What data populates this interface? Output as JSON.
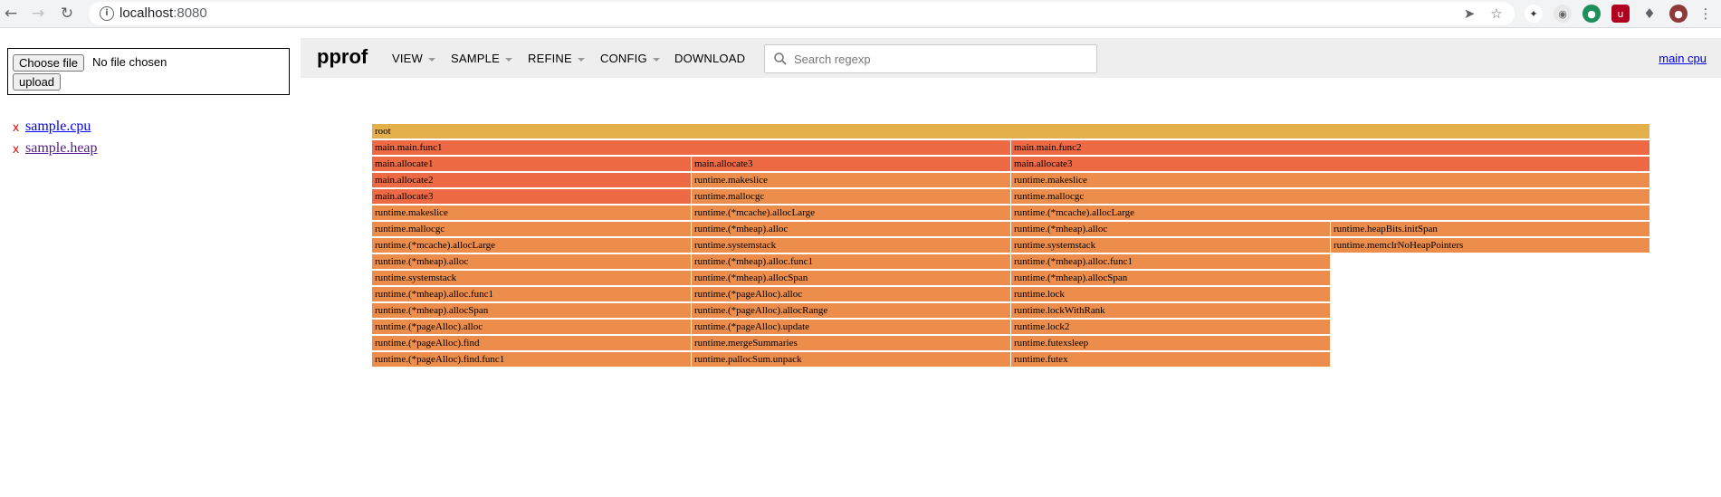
{
  "browser": {
    "url_host": "localhost",
    "url_port": ":8080",
    "icons": [
      "back-icon",
      "forward-icon",
      "reload-icon",
      "info-icon",
      "send-icon",
      "star-icon",
      "extension-icons",
      "puzzle-icon",
      "profile-avatar",
      "kebab-menu-icon"
    ]
  },
  "upload": {
    "choose_label": "Choose file",
    "no_file_text": "No file chosen",
    "upload_label": "upload"
  },
  "files": [
    {
      "x": "x",
      "name": "sample.cpu",
      "visited": false
    },
    {
      "x": "x",
      "name": "sample.heap",
      "visited": true
    }
  ],
  "header": {
    "title": "pprof",
    "menu": [
      "VIEW",
      "SAMPLE",
      "REFINE",
      "CONFIG",
      "DOWNLOAD"
    ],
    "search_placeholder": "Search regexp",
    "profile_link": "main cpu"
  },
  "colors": {
    "root": "#e3b04b",
    "hot": "#ee6a45",
    "warm": "#ec8d4b",
    "header_bg": "#eeeeee",
    "link": "#0000ee"
  },
  "flame": {
    "rows": [
      [
        {
          "name": "root",
          "w": 4,
          "c": "root"
        }
      ],
      [
        {
          "name": "main.main.func1",
          "w": 2,
          "c": "hot"
        },
        {
          "name": "main.main.func2",
          "w": 2,
          "c": "hot"
        }
      ],
      [
        {
          "name": "main.allocate1",
          "w": 1,
          "c": "hot"
        },
        {
          "name": "main.allocate3",
          "w": 1,
          "c": "hot"
        },
        {
          "name": "main.allocate3",
          "w": 2,
          "c": "hot"
        }
      ],
      [
        {
          "name": "main.allocate2",
          "w": 1,
          "c": "hot"
        },
        {
          "name": "runtime.makeslice",
          "w": 1,
          "c": "warm"
        },
        {
          "name": "runtime.makeslice",
          "w": 2,
          "c": "warm"
        }
      ],
      [
        {
          "name": "main.allocate3",
          "w": 1,
          "c": "hot"
        },
        {
          "name": "runtime.mallocgc",
          "w": 1,
          "c": "warm"
        },
        {
          "name": "runtime.mallocgc",
          "w": 2,
          "c": "warm"
        }
      ],
      [
        {
          "name": "runtime.makeslice",
          "w": 1,
          "c": "warm"
        },
        {
          "name": "runtime.(*mcache).allocLarge",
          "w": 1,
          "c": "warm"
        },
        {
          "name": "runtime.(*mcache).allocLarge",
          "w": 2,
          "c": "warm"
        }
      ],
      [
        {
          "name": "runtime.mallocgc",
          "w": 1,
          "c": "warm"
        },
        {
          "name": "runtime.(*mheap).alloc",
          "w": 1,
          "c": "warm"
        },
        {
          "name": "runtime.(*mheap).alloc",
          "w": 1,
          "c": "warm"
        },
        {
          "name": "runtime.heapBits.initSpan",
          "w": 1,
          "c": "warm"
        }
      ],
      [
        {
          "name": "runtime.(*mcache).allocLarge",
          "w": 1,
          "c": "warm"
        },
        {
          "name": "runtime.systemstack",
          "w": 1,
          "c": "warm"
        },
        {
          "name": "runtime.systemstack",
          "w": 1,
          "c": "warm"
        },
        {
          "name": "runtime.memclrNoHeapPointers",
          "w": 1,
          "c": "warm"
        }
      ],
      [
        {
          "name": "runtime.(*mheap).alloc",
          "w": 1,
          "c": "warm"
        },
        {
          "name": "runtime.(*mheap).alloc.func1",
          "w": 1,
          "c": "warm"
        },
        {
          "name": "runtime.(*mheap).alloc.func1",
          "w": 1,
          "c": "warm"
        }
      ],
      [
        {
          "name": "runtime.systemstack",
          "w": 1,
          "c": "warm"
        },
        {
          "name": "runtime.(*mheap).allocSpan",
          "w": 1,
          "c": "warm"
        },
        {
          "name": "runtime.(*mheap).allocSpan",
          "w": 1,
          "c": "warm"
        }
      ],
      [
        {
          "name": "runtime.(*mheap).alloc.func1",
          "w": 1,
          "c": "warm"
        },
        {
          "name": "runtime.(*pageAlloc).alloc",
          "w": 1,
          "c": "warm"
        },
        {
          "name": "runtime.lock",
          "w": 1,
          "c": "warm"
        }
      ],
      [
        {
          "name": "runtime.(*mheap).allocSpan",
          "w": 1,
          "c": "warm"
        },
        {
          "name": "runtime.(*pageAlloc).allocRange",
          "w": 1,
          "c": "warm"
        },
        {
          "name": "runtime.lockWithRank",
          "w": 1,
          "c": "warm"
        }
      ],
      [
        {
          "name": "runtime.(*pageAlloc).alloc",
          "w": 1,
          "c": "warm"
        },
        {
          "name": "runtime.(*pageAlloc).update",
          "w": 1,
          "c": "warm"
        },
        {
          "name": "runtime.lock2",
          "w": 1,
          "c": "warm"
        }
      ],
      [
        {
          "name": "runtime.(*pageAlloc).find",
          "w": 1,
          "c": "warm"
        },
        {
          "name": "runtime.mergeSummaries",
          "w": 1,
          "c": "warm"
        },
        {
          "name": "runtime.futexsleep",
          "w": 1,
          "c": "warm"
        }
      ],
      [
        {
          "name": "runtime.(*pageAlloc).find.func1",
          "w": 1,
          "c": "warm"
        },
        {
          "name": "runtime.pallocSum.unpack",
          "w": 1,
          "c": "warm"
        },
        {
          "name": "runtime.futex",
          "w": 1,
          "c": "warm"
        }
      ]
    ]
  }
}
